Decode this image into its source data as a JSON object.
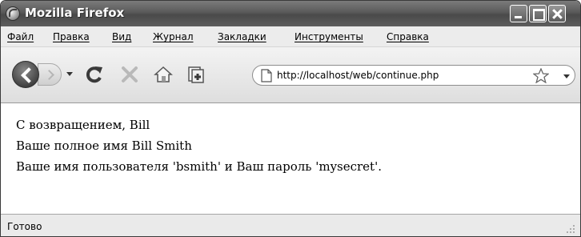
{
  "window": {
    "title": "Mozilla Firefox"
  },
  "menu": {
    "items": [
      "Файл",
      "Правка",
      "Вид",
      "Журнал",
      "Закладки",
      "Инструменты",
      "Справка"
    ]
  },
  "toolbar": {
    "icons": [
      "back-icon",
      "forward-icon",
      "reload-icon",
      "stop-icon",
      "home-icon",
      "bookmark-page-icon"
    ]
  },
  "address_bar": {
    "url": "http://localhost/web/continue.php"
  },
  "content": {
    "lines": [
      "С возвращением, Bill",
      "Ваше полное имя Bill Smith",
      "Ваше имя пользователя 'bsmith' и Ваш пароль 'mysecret'."
    ]
  },
  "status_bar": {
    "text": "Готово"
  }
}
